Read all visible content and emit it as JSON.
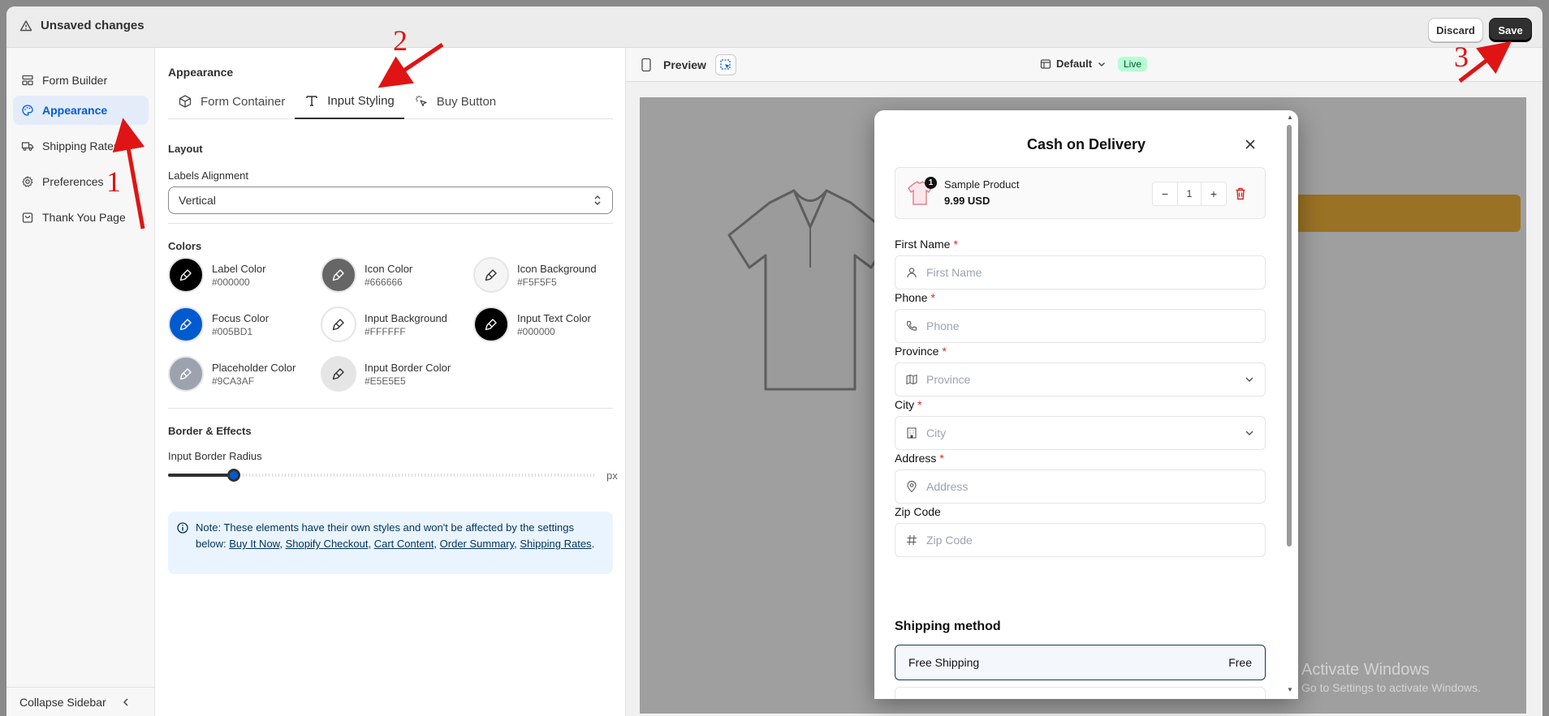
{
  "topbar": {
    "status_text": "Unsaved changes",
    "discard_label": "Discard",
    "save_label": "Save"
  },
  "sidebar": {
    "items": [
      {
        "label": "Form Builder",
        "icon": "layout-icon"
      },
      {
        "label": "Appearance",
        "icon": "palette-icon",
        "active": true
      },
      {
        "label": "Shipping Rates",
        "icon": "truck-icon"
      },
      {
        "label": "Preferences",
        "icon": "gear-icon"
      },
      {
        "label": "Thank You Page",
        "icon": "bag-icon"
      }
    ],
    "collapse_label": "Collapse Sidebar"
  },
  "settings": {
    "header": "Appearance",
    "tabs": [
      {
        "label": "Form Container",
        "icon": "box-icon"
      },
      {
        "label": "Input Styling",
        "icon": "text-icon",
        "active": true
      },
      {
        "label": "Buy Button",
        "icon": "click-icon"
      }
    ],
    "layout_title": "Layout",
    "labels_alignment_label": "Labels Alignment",
    "labels_alignment_value": "Vertical",
    "colors_title": "Colors",
    "colors": [
      {
        "name": "Label Color",
        "hex": "#000000",
        "swatch": "#000000"
      },
      {
        "name": "Icon Color",
        "hex": "#666666",
        "swatch": "#666666"
      },
      {
        "name": "Icon Background",
        "hex": "#F5F5F5",
        "swatch": "#F5F5F5"
      },
      {
        "name": "Focus Color",
        "hex": "#005BD1",
        "swatch": "#005BD1"
      },
      {
        "name": "Input Background",
        "hex": "#FFFFFF",
        "swatch": "#FFFFFF"
      },
      {
        "name": "Input Text Color",
        "hex": "#000000",
        "swatch": "#000000"
      },
      {
        "name": "Placeholder Color",
        "hex": "#9CA3AF",
        "swatch": "#9CA3AF"
      },
      {
        "name": "Input Border Color",
        "hex": "#E5E5E5",
        "swatch": "#E5E5E5"
      }
    ],
    "border_title": "Border & Effects",
    "radius_label": "Input Border Radius",
    "radius_unit": "px",
    "radius_fraction": 0.155,
    "note": {
      "text_before": "Note: These elements have their own styles and won't be affected by the settings below: ",
      "links": [
        "Buy It Now",
        "Shopify Checkout",
        "Cart Content",
        "Order Summary",
        "Shipping Rates"
      ],
      "text_after": "."
    }
  },
  "preview": {
    "label": "Preview",
    "theme_label": "Default",
    "live_badge": "Live",
    "modal": {
      "title": "Cash on Delivery",
      "product_name": "Sample Product",
      "product_price": "9.99 USD",
      "quantity": "1",
      "cart_count": "1",
      "fields": [
        {
          "label": "First Name",
          "required": true,
          "placeholder": "First Name",
          "icon": "user-icon",
          "dropdown": false
        },
        {
          "label": "Phone",
          "required": true,
          "placeholder": "Phone",
          "icon": "phone-icon",
          "dropdown": false
        },
        {
          "label": "Province",
          "required": true,
          "placeholder": "Province",
          "icon": "map-icon",
          "dropdown": true
        },
        {
          "label": "City",
          "required": true,
          "placeholder": "City",
          "icon": "building-icon",
          "dropdown": true
        },
        {
          "label": "Address",
          "required": true,
          "placeholder": "Address",
          "icon": "pin-icon",
          "dropdown": false
        },
        {
          "label": "Zip Code",
          "required": false,
          "placeholder": "Zip Code",
          "icon": "hash-icon",
          "dropdown": false
        }
      ],
      "shipping_heading": "Shipping method",
      "shipping_option": "Free Shipping",
      "shipping_price": "Free"
    }
  },
  "watermark": {
    "line1": "Activate Windows",
    "line2": "Go to Settings to activate Windows."
  },
  "annotations": [
    "1",
    "2",
    "3"
  ],
  "accent_colors": {
    "primary": "#005bd3",
    "annotation": "#e01414",
    "live_bg": "#b4fed2"
  }
}
